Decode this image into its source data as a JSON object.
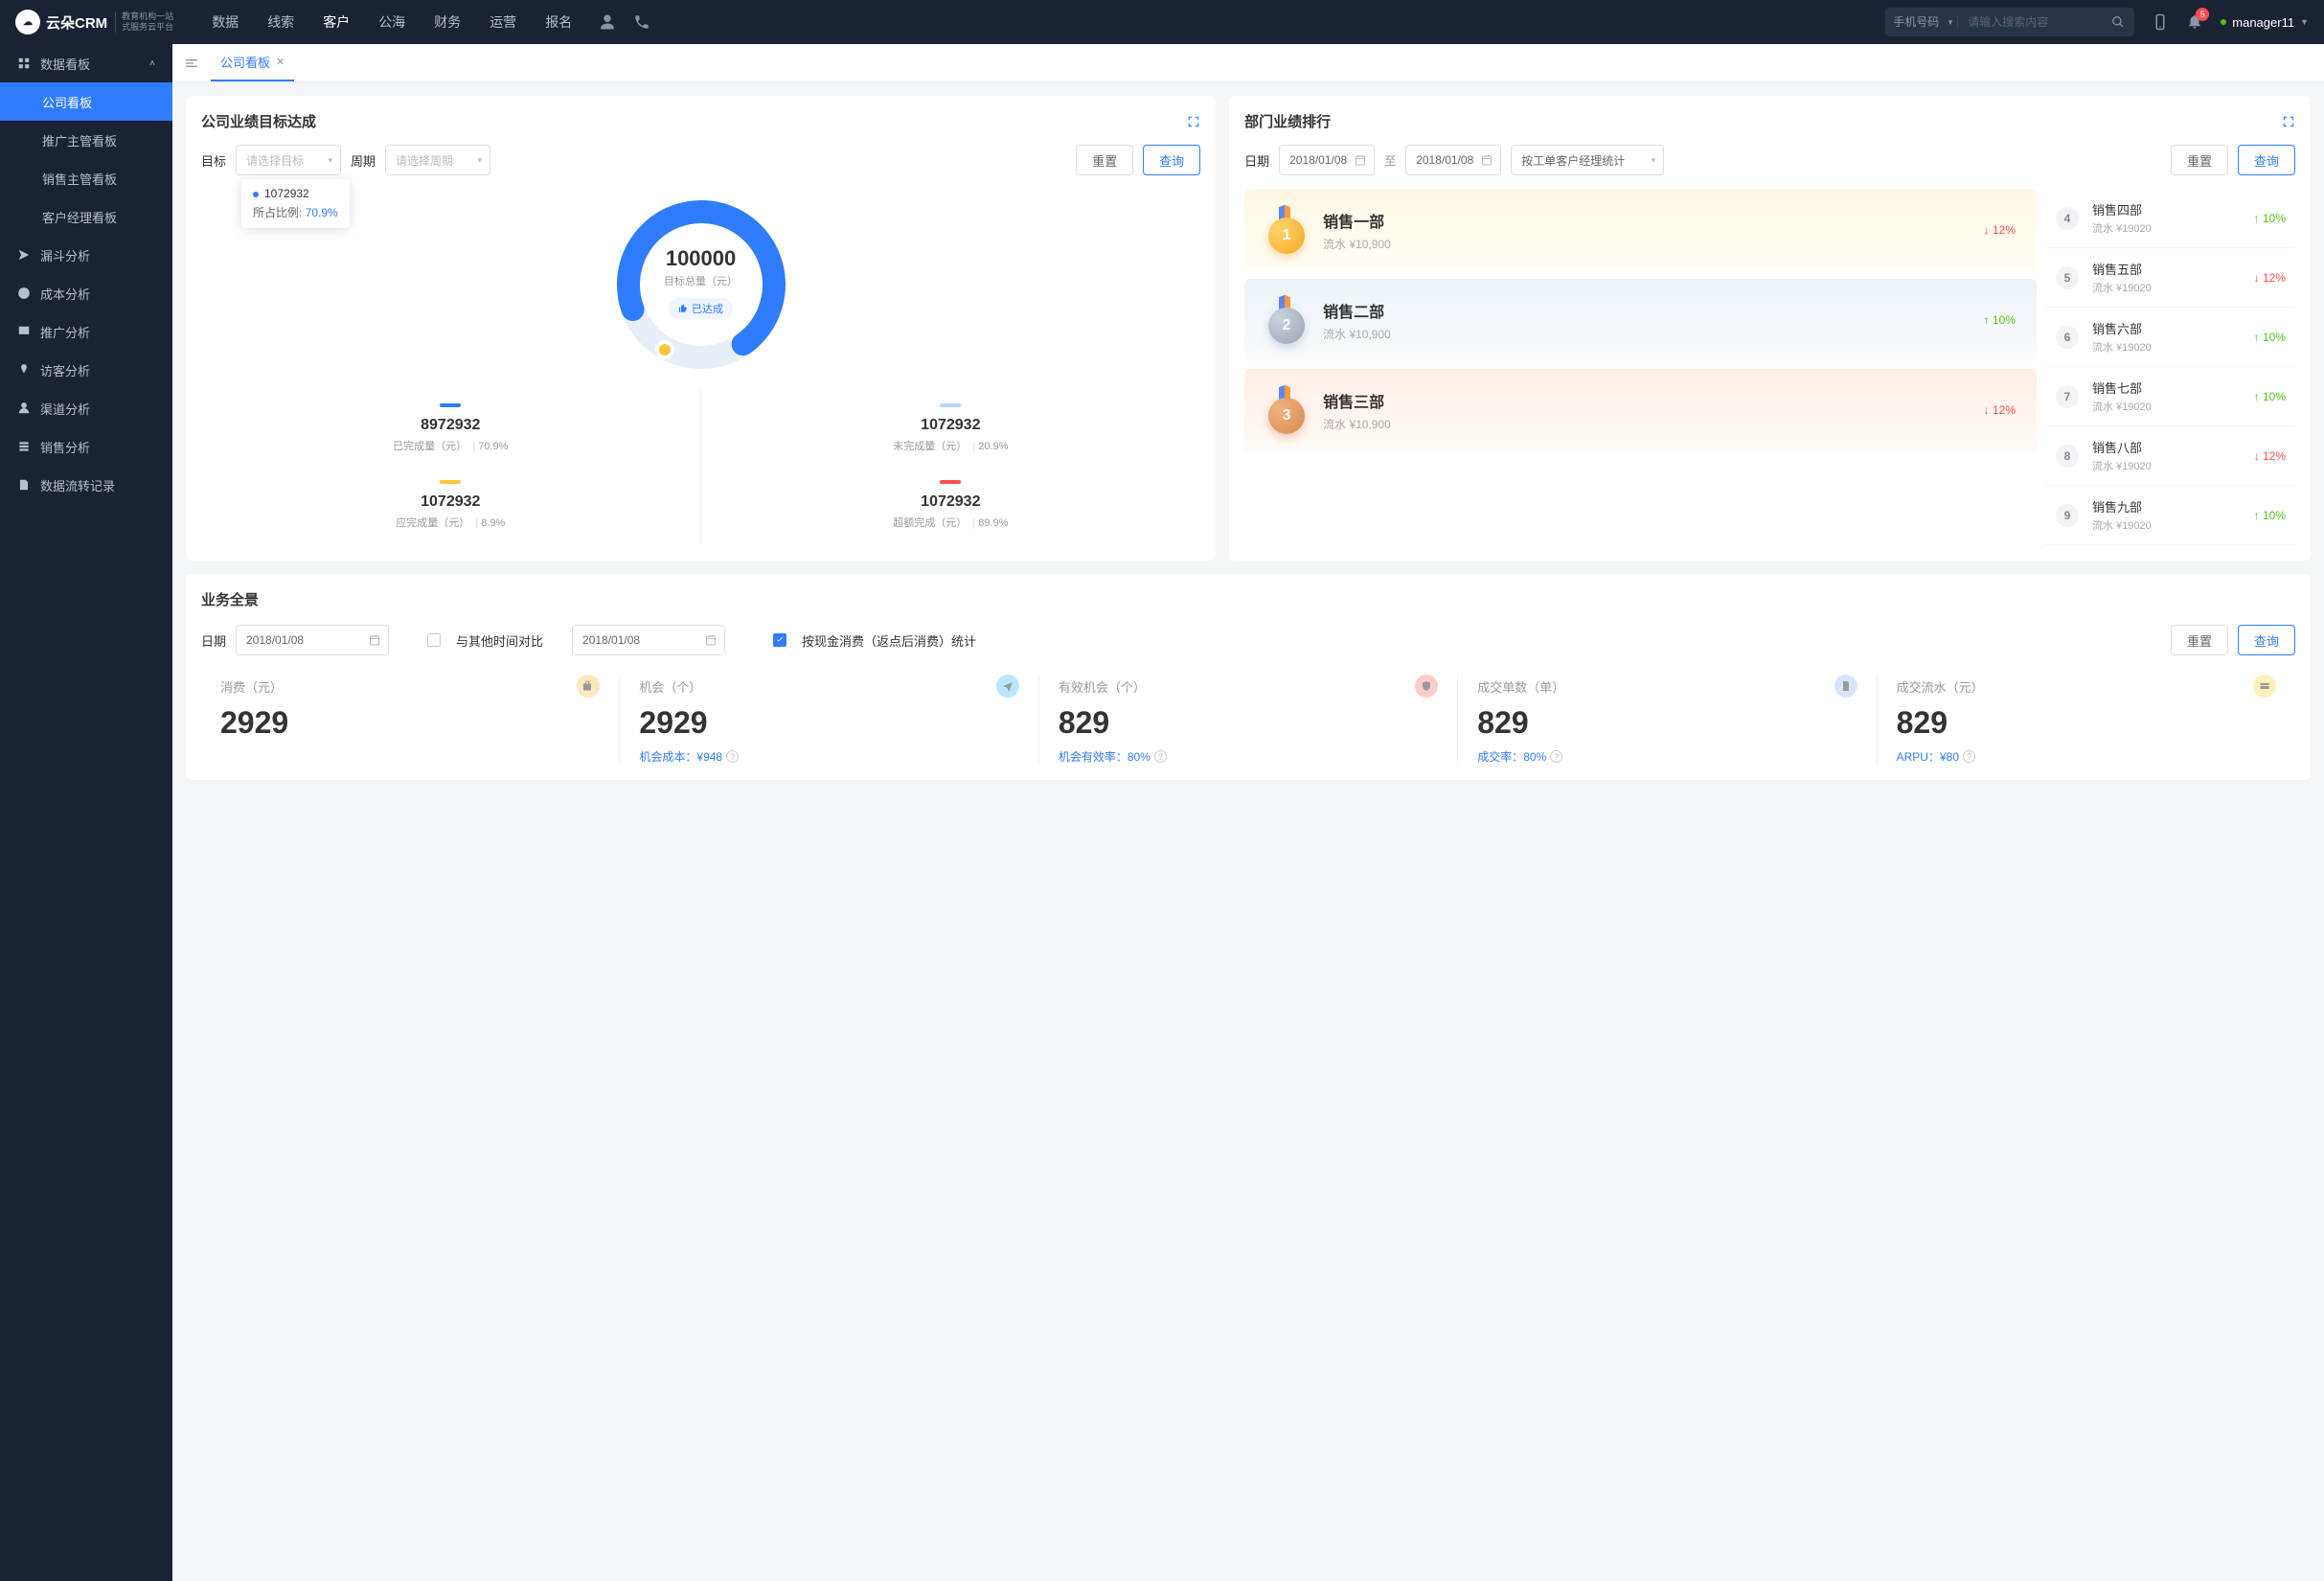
{
  "brand": {
    "name": "云朵CRM",
    "sub1": "教育机构一站",
    "sub2": "式服务云平台"
  },
  "topnav": [
    "数据",
    "线索",
    "客户",
    "公海",
    "财务",
    "运营",
    "报名"
  ],
  "topnav_active": 2,
  "search": {
    "type": "手机号码",
    "placeholder": "请输入搜索内容"
  },
  "notif_count": "5",
  "user": {
    "name": "manager11"
  },
  "sidebar": {
    "group": {
      "label": "数据看板",
      "open": true,
      "items": [
        "公司看板",
        "推广主管看板",
        "销售主管看板",
        "客户经理看板"
      ],
      "active": 0
    },
    "rest": [
      "漏斗分析",
      "成本分析",
      "推广分析",
      "访客分析",
      "渠道分析",
      "销售分析",
      "数据流转记录"
    ]
  },
  "tab": {
    "label": "公司看板"
  },
  "goal_card": {
    "title": "公司业绩目标达成",
    "filters": {
      "target_label": "目标",
      "target_ph": "请选择目标",
      "period_label": "周期",
      "period_ph": "请选择周期",
      "reset": "重置",
      "query": "查询"
    },
    "tooltip": {
      "value": "1072932",
      "label": "所占比例:",
      "pct": "70.9%"
    },
    "center": {
      "num": "100000",
      "label": "目标总量（元）",
      "achieved": "已达成"
    },
    "stats": [
      {
        "bar": "#2f7cff",
        "num": "8972932",
        "label": "已完成量（元）",
        "pct": "70.9%"
      },
      {
        "bar": "#b8d4ff",
        "num": "1072932",
        "label": "未完成量（元）",
        "pct": "20.9%"
      },
      {
        "bar": "#ffc53d",
        "num": "1072932",
        "label": "应完成量（元）",
        "pct": "8.9%"
      },
      {
        "bar": "#ff4d4f",
        "num": "1072932",
        "label": "超额完成（元）",
        "pct": "89.9%"
      }
    ]
  },
  "rank_card": {
    "title": "部门业绩排行",
    "filters": {
      "date_label": "日期",
      "date1": "2018/01/08",
      "sep": "至",
      "date2": "2018/01/08",
      "mode": "按工单客户经理统计",
      "reset": "重置",
      "query": "查询"
    },
    "top3": [
      {
        "rank": "1",
        "name": "销售一部",
        "sub": "流水 ¥10,900",
        "pct": "12%",
        "dir": "down"
      },
      {
        "rank": "2",
        "name": "销售二部",
        "sub": "流水 ¥10,900",
        "pct": "10%",
        "dir": "up"
      },
      {
        "rank": "3",
        "name": "销售三部",
        "sub": "流水 ¥10,900",
        "pct": "12%",
        "dir": "down"
      }
    ],
    "rest": [
      {
        "rank": "4",
        "name": "销售四部",
        "sub": "流水 ¥19020",
        "pct": "10%",
        "dir": "up"
      },
      {
        "rank": "5",
        "name": "销售五部",
        "sub": "流水 ¥19020",
        "pct": "12%",
        "dir": "down"
      },
      {
        "rank": "6",
        "name": "销售六部",
        "sub": "流水 ¥19020",
        "pct": "10%",
        "dir": "up"
      },
      {
        "rank": "7",
        "name": "销售七部",
        "sub": "流水 ¥19020",
        "pct": "10%",
        "dir": "up"
      },
      {
        "rank": "8",
        "name": "销售八部",
        "sub": "流水 ¥19020",
        "pct": "12%",
        "dir": "down"
      },
      {
        "rank": "9",
        "name": "销售九部",
        "sub": "流水 ¥19020",
        "pct": "10%",
        "dir": "up"
      }
    ]
  },
  "overview": {
    "title": "业务全景",
    "filters": {
      "date_label": "日期",
      "date1": "2018/01/08",
      "compare_label": "与其他时间对比",
      "date2": "2018/01/08",
      "check_label": "按现金消费（返点后消费）统计",
      "reset": "重置",
      "query": "查询"
    },
    "metrics": [
      {
        "label": "消费（元）",
        "num": "2929",
        "foot": "",
        "iconbg": "#ffe7ba",
        "icon": "bag"
      },
      {
        "label": "机会（个）",
        "num": "2929",
        "foot_label": "机会成本：",
        "foot_val": "¥948",
        "iconbg": "#bae7ff",
        "icon": "plane"
      },
      {
        "label": "有效机会（个）",
        "num": "829",
        "foot_label": "机会有效率：",
        "foot_val": "80%",
        "iconbg": "#ffccc7",
        "icon": "shield"
      },
      {
        "label": "成交单数（单）",
        "num": "829",
        "foot_label": "成交率：",
        "foot_val": "80%",
        "iconbg": "#d6e4ff",
        "icon": "doc"
      },
      {
        "label": "成交流水（元）",
        "num": "829",
        "foot_label": "ARPU：",
        "foot_val": "¥80",
        "iconbg": "#fff1b8",
        "icon": "card"
      }
    ]
  },
  "chart_data": {
    "type": "pie",
    "title": "目标总量（元）",
    "total": 100000,
    "series": [
      {
        "name": "已完成量",
        "value": 8972932,
        "pct": 70.9,
        "color": "#2f7cff"
      },
      {
        "name": "未完成量",
        "value": 1072932,
        "pct": 20.9,
        "color": "#b8d4ff"
      },
      {
        "name": "应完成量",
        "value": 1072932,
        "pct": 8.9,
        "color": "#ffc53d"
      },
      {
        "name": "超额完成",
        "value": 1072932,
        "pct": 89.9,
        "color": "#ff4d4f"
      }
    ],
    "achieved": true,
    "tooltip": {
      "value": 1072932,
      "pct": 70.9
    }
  }
}
